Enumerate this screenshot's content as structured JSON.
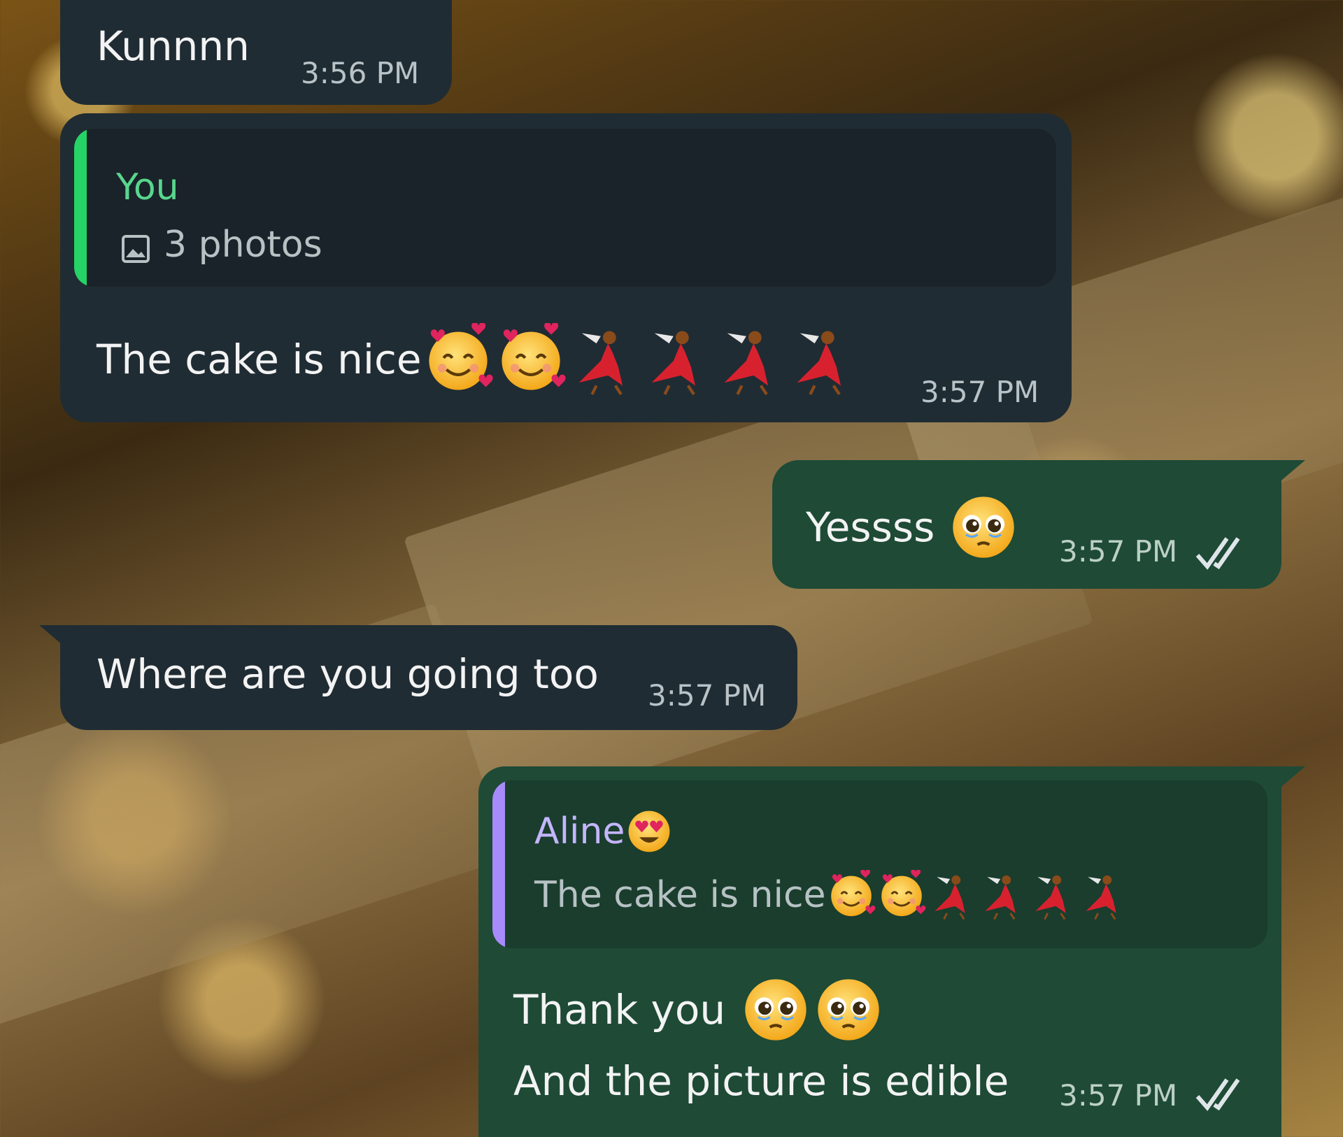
{
  "theme": {
    "incoming_bubble": "#202c33",
    "outgoing_bubble": "#1e4a36",
    "quote_bar_you": "#25d366",
    "quote_bar_aline": "#a78bfa",
    "quote_author_you": "#58d68d",
    "quote_author_aline": "#c4b5fd",
    "read_ticks": "#dfe6e9"
  },
  "messages": [
    {
      "direction": "incoming",
      "text": "Kunnnn",
      "time": "3:56 PM"
    },
    {
      "direction": "incoming",
      "quote": {
        "author": "You",
        "icon": "photo-icon",
        "text": "3 photos"
      },
      "text": "The cake is nice",
      "emojis": [
        "smiling-face-with-hearts",
        "smiling-face-with-hearts",
        "dancer",
        "dancer",
        "dancer",
        "dancer"
      ],
      "time": "3:57 PM"
    },
    {
      "direction": "outgoing",
      "text": "Yessss",
      "emojis": [
        "pleading-face"
      ],
      "time": "3:57 PM",
      "status": "read-double-check"
    },
    {
      "direction": "incoming",
      "text": "Where are you going too",
      "time": "3:57 PM"
    },
    {
      "direction": "outgoing",
      "quote": {
        "author": "Aline",
        "author_emoji": "heart-eyes",
        "text": "The cake is nice",
        "emojis": [
          "smiling-face-with-hearts",
          "smiling-face-with-hearts",
          "dancer",
          "dancer",
          "dancer",
          "dancer"
        ]
      },
      "line1": "Thank you",
      "line1_emojis": [
        "pleading-face",
        "pleading-face"
      ],
      "line2": "And the picture is edible",
      "time": "3:57 PM",
      "status": "read-double-check"
    }
  ]
}
